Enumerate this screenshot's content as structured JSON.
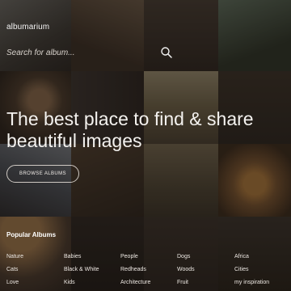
{
  "header": {
    "brand": "albumarium"
  },
  "search": {
    "placeholder": "Search for album..."
  },
  "hero": {
    "line1": "The best place to find & share",
    "line2": "beautiful images"
  },
  "browse_button": {
    "label": "BROWSE ALBUMS"
  },
  "popular": {
    "title": "Popular Albums",
    "rows": [
      [
        "Nature",
        "Babies",
        "People",
        "Dogs",
        "Africa"
      ],
      [
        "Cats",
        "Black & White",
        "Redheads",
        "Woods",
        "Cities"
      ],
      [
        "Love",
        "Kids",
        "Architecture",
        "Fruit",
        "my inspiration"
      ]
    ]
  },
  "colors": {
    "accent_text": "#ffffff",
    "overlay": "#140f0c"
  }
}
